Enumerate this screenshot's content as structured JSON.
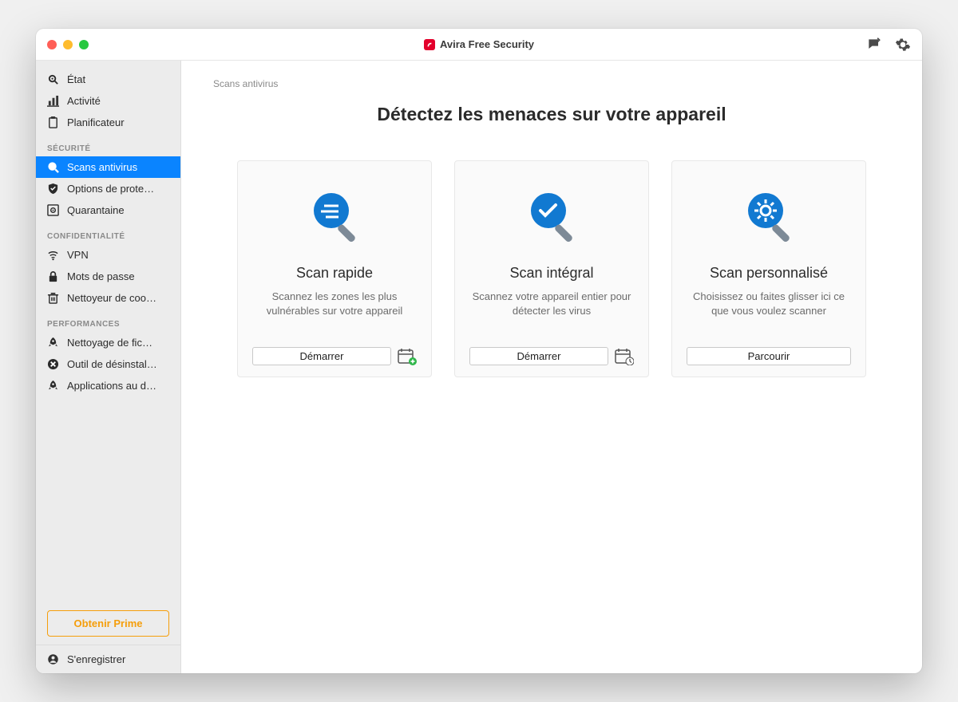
{
  "window": {
    "title": "Avira Free Security"
  },
  "sidebar": {
    "top": [
      {
        "label": "État",
        "icon": "monitor-magnify-icon"
      },
      {
        "label": "Activité",
        "icon": "bar-chart-icon"
      },
      {
        "label": "Planificateur",
        "icon": "clipboard-icon"
      }
    ],
    "sections": [
      {
        "header": "SÉCURITÉ",
        "items": [
          {
            "label": "Scans antivirus",
            "icon": "scan-icon",
            "active": true
          },
          {
            "label": "Options de prote…",
            "icon": "shield-check-icon"
          },
          {
            "label": "Quarantaine",
            "icon": "vault-icon"
          }
        ]
      },
      {
        "header": "CONFIDENTIALITÉ",
        "items": [
          {
            "label": "VPN",
            "icon": "wifi-lock-icon"
          },
          {
            "label": "Mots de passe",
            "icon": "lock-icon"
          },
          {
            "label": "Nettoyeur de coo…",
            "icon": "trash-icon"
          }
        ]
      },
      {
        "header": "PERFORMANCES",
        "items": [
          {
            "label": "Nettoyage de fic…",
            "icon": "rocket-icon"
          },
          {
            "label": "Outil de désinstal…",
            "icon": "remove-circle-icon"
          },
          {
            "label": "Applications au d…",
            "icon": "rocket-icon"
          }
        ]
      }
    ],
    "prime_label": "Obtenir Prime",
    "register_label": "S'enregistrer"
  },
  "main": {
    "breadcrumb": "Scans antivirus",
    "title": "Détectez les menaces sur votre appareil",
    "cards": [
      {
        "title": "Scan rapide",
        "desc": "Scannez les zones les plus vulnérables sur votre appareil",
        "button": "Démarrer",
        "icon": "magnify-lines",
        "schedule": "calendar-plus"
      },
      {
        "title": "Scan intégral",
        "desc": "Scannez votre appareil entier pour détecter les virus",
        "button": "Démarrer",
        "icon": "magnify-check",
        "schedule": "calendar-clock"
      },
      {
        "title": "Scan personnalisé",
        "desc": "Choisissez ou faites glisser ici ce que vous voulez scanner",
        "button": "Parcourir",
        "icon": "magnify-gear",
        "schedule": null
      }
    ]
  },
  "colors": {
    "accent": "#1179d1",
    "primary": "#0a84ff",
    "prime": "#f59e0b",
    "brand": "#e3002b"
  }
}
